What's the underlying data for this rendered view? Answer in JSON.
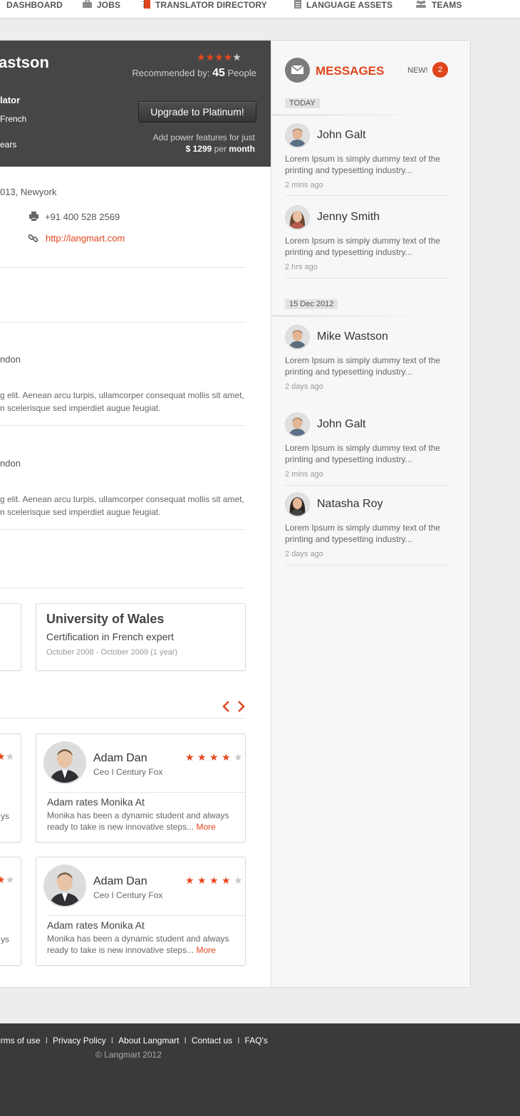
{
  "nav": {
    "items": [
      {
        "label": "DASHBOARD",
        "icon": "dashboard-icon"
      },
      {
        "label": "JOBS",
        "icon": "briefcase-icon"
      },
      {
        "label": "TRANSLATOR DIRECTORY",
        "icon": "book-icon"
      },
      {
        "label": "LANGUAGE ASSETS",
        "icon": "document-icon"
      },
      {
        "label": "TEAMS",
        "icon": "team-icon"
      }
    ]
  },
  "profile": {
    "name": "astson",
    "role": "lator",
    "language": "French",
    "experience": "ears",
    "rating": 4,
    "rating_max": 5,
    "recommended_label": "Recommended by:",
    "recommended_count": "45",
    "recommended_suffix": "People",
    "upgrade_label": "Upgrade to Platinum!",
    "power_text": "Add power features for just",
    "price": "$ 1299",
    "per": "per",
    "period": "month",
    "address": "013, Newyork",
    "phone": "+91 400 528 2569",
    "website": "http://langmart.com"
  },
  "experience_items": [
    {
      "place": "ndon",
      "text1": "g elit. Aenean arcu turpis, ullamcorper consequat mollis sit amet,",
      "text2": "n scelerisque sed imperdiet augue feugiat."
    },
    {
      "place": "ndon",
      "text1": "g elit. Aenean arcu turpis, ullamcorper consequat mollis sit amet,",
      "text2": "n scelerisque sed imperdiet augue feugiat."
    }
  ],
  "education": {
    "school": "University of Wales",
    "cert": "Certification in French expert",
    "dates": "October 2008 - October 2009 (1 year)"
  },
  "recommendations": [
    {
      "name": "Adam Dan",
      "title": "Ceo I Century Fox",
      "rating": 4,
      "heading": "Adam rates Monika At",
      "text1": "Monika has been a dynamic student and always",
      "text2": "ready to take is new innovative steps...",
      "more": "More",
      "partial": "ys"
    },
    {
      "name": "Adam Dan",
      "title": "Ceo I Century Fox",
      "rating": 4,
      "heading": "Adam rates Monika At",
      "text1": "Monika has been a dynamic student and always",
      "text2": "ready to take is new innovative steps...",
      "more": "More",
      "partial": "ys"
    }
  ],
  "messages": {
    "title": "MESSAGES",
    "new_label": "NEW!",
    "new_count": "2",
    "groups": [
      {
        "day": "TODAY",
        "items": [
          {
            "name": "John Galt",
            "text": "Lorem Ipsum is simply dummy text of the printing and typesetting industry...",
            "time": "2 mins ago"
          },
          {
            "name": "Jenny Smith",
            "text": "Lorem Ipsum is simply dummy text of the printing and typesetting industry...",
            "time": "2 hrs ago"
          }
        ]
      },
      {
        "day": "15 Dec 2012",
        "items": [
          {
            "name": "Mike Wastson",
            "text": "Lorem Ipsum is simply dummy text of the printing and typesetting industry...",
            "time": "2 days ago"
          },
          {
            "name": "John Galt",
            "text": "Lorem Ipsum is simply dummy text of the printing and typesetting industry...",
            "time": "2 mins ago"
          },
          {
            "name": "Natasha Roy",
            "text": "Lorem Ipsum is simply dummy text of the printing and typesetting industry...",
            "time": "2 days ago"
          }
        ]
      }
    ]
  },
  "footer": {
    "links": [
      "erms of use",
      "Privacy Policy",
      "About Langmart",
      "Contact us",
      "FAQ's"
    ],
    "separator": "I",
    "copyright": "© Langmart 2012"
  },
  "colors": {
    "accent": "#e0461d",
    "dark": "#464646"
  }
}
